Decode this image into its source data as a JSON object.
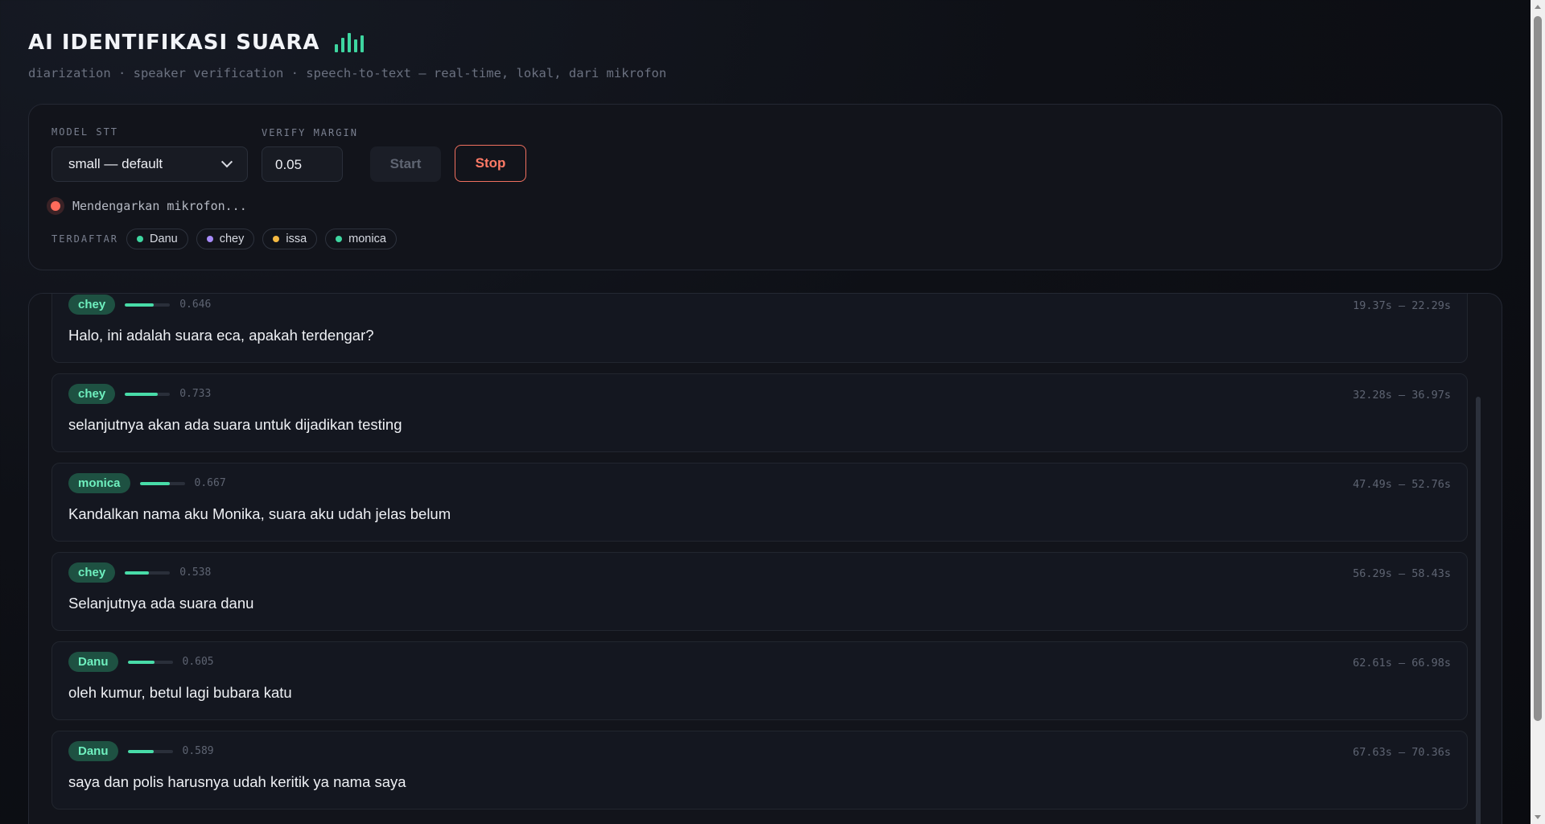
{
  "header": {
    "title": "AI IDENTIFIKASI SUARA",
    "icon": "audio-bars-icon",
    "subtitle": "diarization · speaker verification · speech-to-text — real-time, lokal, dari mikrofon"
  },
  "controls": {
    "model_label": "MODEL STT",
    "model_value": "small — default",
    "margin_label": "VERIFY MARGIN",
    "margin_value": "0.05",
    "start_label": "Start",
    "stop_label": "Stop",
    "status_text": "Mendengarkan mikrofon...",
    "status_color": "#ff6b5b",
    "registered_label": "TERDAFTAR",
    "registered": [
      {
        "name": "Danu",
        "color": "#3ed6a0"
      },
      {
        "name": "chey",
        "color": "#a78bfa"
      },
      {
        "name": "issa",
        "color": "#f5b942"
      },
      {
        "name": "monica",
        "color": "#3ed6a0"
      }
    ]
  },
  "transcript": [
    {
      "speaker": "chey",
      "score": "0.646",
      "score_fraction": 0.646,
      "time": "19.37s – 22.29s",
      "text": "Halo, ini adalah suara eca, apakah terdengar?"
    },
    {
      "speaker": "chey",
      "score": "0.733",
      "score_fraction": 0.733,
      "time": "32.28s – 36.97s",
      "text": "selanjutnya akan ada suara untuk dijadikan testing"
    },
    {
      "speaker": "monica",
      "score": "0.667",
      "score_fraction": 0.667,
      "time": "47.49s – 52.76s",
      "text": "Kandalkan nama aku Monika, suara aku udah jelas belum"
    },
    {
      "speaker": "chey",
      "score": "0.538",
      "score_fraction": 0.538,
      "time": "56.29s – 58.43s",
      "text": "Selanjutnya ada suara danu"
    },
    {
      "speaker": "Danu",
      "score": "0.605",
      "score_fraction": 0.605,
      "time": "62.61s – 66.98s",
      "text": "oleh kumur, betul lagi bubara katu"
    },
    {
      "speaker": "Danu",
      "score": "0.589",
      "score_fraction": 0.589,
      "time": "67.63s – 70.36s",
      "text": "saya dan polis harusnya udah keritik ya nama saya"
    }
  ],
  "colors": {
    "accent": "#3ed6a0",
    "stop": "#ff7a66",
    "background": "#0e1016"
  }
}
